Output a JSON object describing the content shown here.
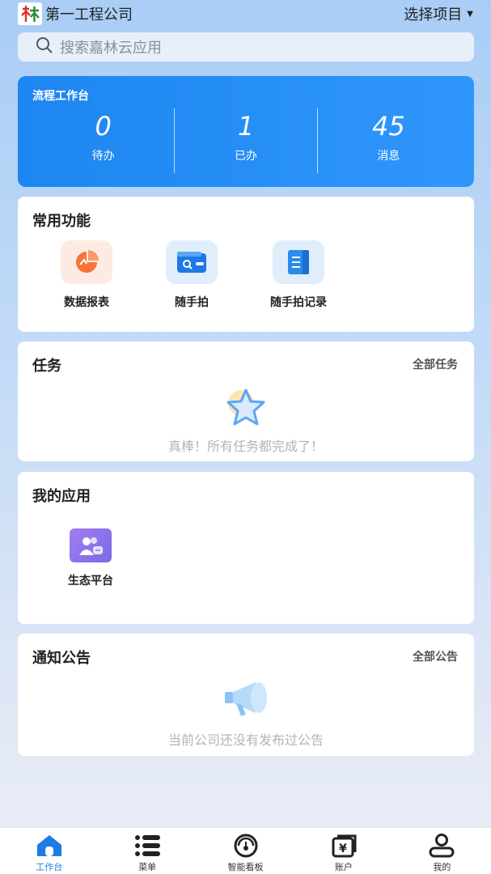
{
  "header": {
    "company": "第一工程公司",
    "select_project": "选择项目",
    "logo_text": "林"
  },
  "search": {
    "placeholder": "搜索嘉林云应用"
  },
  "workflow": {
    "title": "流程工作台",
    "stats": [
      {
        "value": "0",
        "label": "待办"
      },
      {
        "value": "1",
        "label": "已办"
      },
      {
        "value": "45",
        "label": "消息"
      }
    ]
  },
  "common_functions": {
    "title": "常用功能",
    "items": [
      {
        "label": "数据报表",
        "icon": "pie-chart-icon",
        "color": "#f4743c"
      },
      {
        "label": "随手拍",
        "icon": "wallet-search-icon",
        "color": "#1e78e6"
      },
      {
        "label": "随手拍记录",
        "icon": "notebook-icon",
        "color": "#2b8cef"
      }
    ]
  },
  "tasks": {
    "title": "任务",
    "link": "全部任务",
    "empty_text": "真棒！所有任务都完成了！"
  },
  "my_apps": {
    "title": "我的应用",
    "items": [
      {
        "label": "生态平台",
        "icon": "people-icon",
        "color": "#8b74e8"
      }
    ]
  },
  "notices": {
    "title": "通知公告",
    "link": "全部公告",
    "empty_text": "当前公司还没有发布过公告"
  },
  "tabbar": {
    "items": [
      {
        "label": "工作台",
        "icon": "home-icon",
        "active": true
      },
      {
        "label": "菜单",
        "icon": "menu-list-icon",
        "active": false
      },
      {
        "label": "智能看板",
        "icon": "dashboard-gauge-icon",
        "active": false
      },
      {
        "label": "账户",
        "icon": "wallet-yen-icon",
        "active": false
      },
      {
        "label": "我的",
        "icon": "user-icon",
        "active": false
      }
    ],
    "active_color": "#1e7ce6"
  },
  "colors": {
    "accent": "#1d86f0",
    "background_top": "#a9cdf6"
  }
}
